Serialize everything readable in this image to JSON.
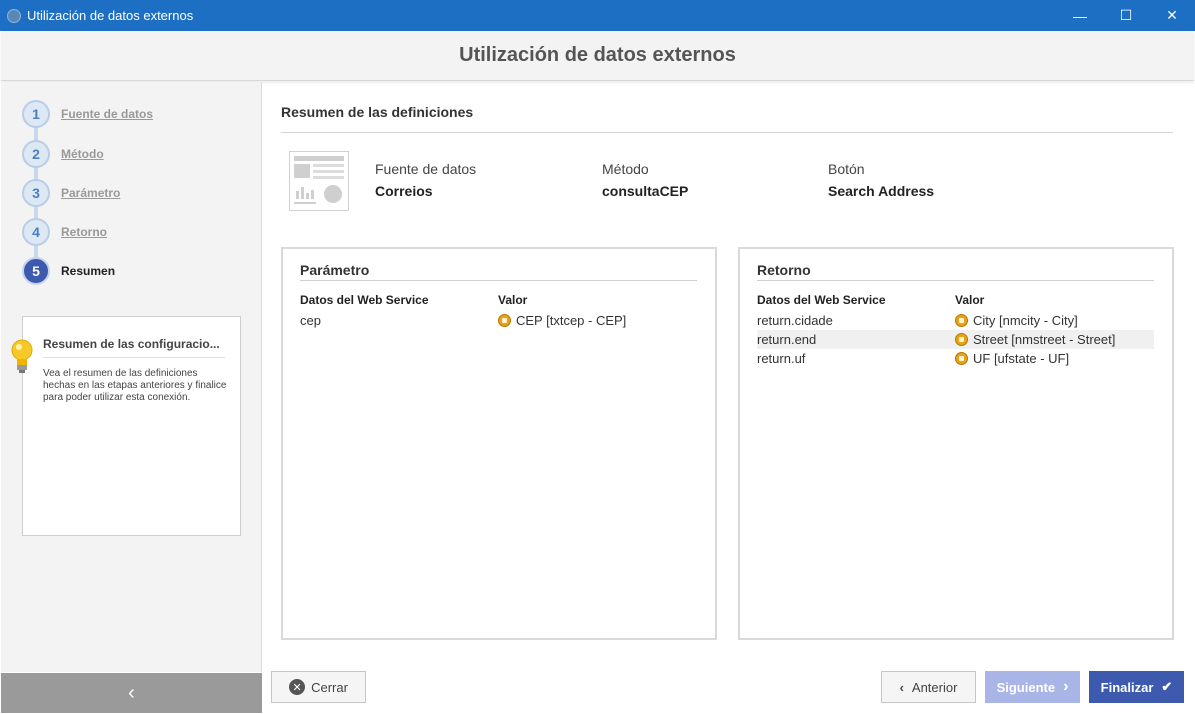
{
  "window": {
    "title": "Utilización de datos externos",
    "minimize": "—",
    "maximize": "☐",
    "close": "✕"
  },
  "header": {
    "title": "Utilización de datos externos"
  },
  "steps": [
    {
      "number": "1",
      "label": "Fuente de datos"
    },
    {
      "number": "2",
      "label": "Método"
    },
    {
      "number": "3",
      "label": "Parámetro"
    },
    {
      "number": "4",
      "label": "Retorno"
    },
    {
      "number": "5",
      "label": "Resumen"
    }
  ],
  "help": {
    "title": "Resumen de las configuracio...",
    "text": "Vea el resumen de las definiciones hechas en las etapas anteriores y finalice para poder utilizar esta conexión."
  },
  "sidebar": {
    "collapse": "‹"
  },
  "summary": {
    "title": "Resumen de las definiciones",
    "info": [
      {
        "key": "Fuente de datos",
        "value": "Correios"
      },
      {
        "key": "Método",
        "value": "consultaCEP"
      },
      {
        "key": "Botón",
        "value": "Search Address"
      }
    ]
  },
  "parametro": {
    "title": "Parámetro",
    "col1": "Datos del Web Service",
    "col2": "Valor",
    "rows": [
      {
        "name": "cep",
        "value": "CEP [txtcep - CEP]"
      }
    ]
  },
  "retorno": {
    "title": "Retorno",
    "col1": "Datos del Web Service",
    "col2": "Valor",
    "rows": [
      {
        "name": "return.cidade",
        "value": "City [nmcity - City]"
      },
      {
        "name": "return.end",
        "value": "Street [nmstreet - Street]"
      },
      {
        "name": "return.uf",
        "value": "UF [ufstate - UF]"
      }
    ]
  },
  "footer": {
    "close": "Cerrar",
    "previous": "Anterior",
    "next": "Siguiente",
    "finish": "Finalizar"
  },
  "colors": {
    "titlebar": "#1d6fc4",
    "accent": "#3d5aae",
    "disabled": "#a8b5e6"
  }
}
